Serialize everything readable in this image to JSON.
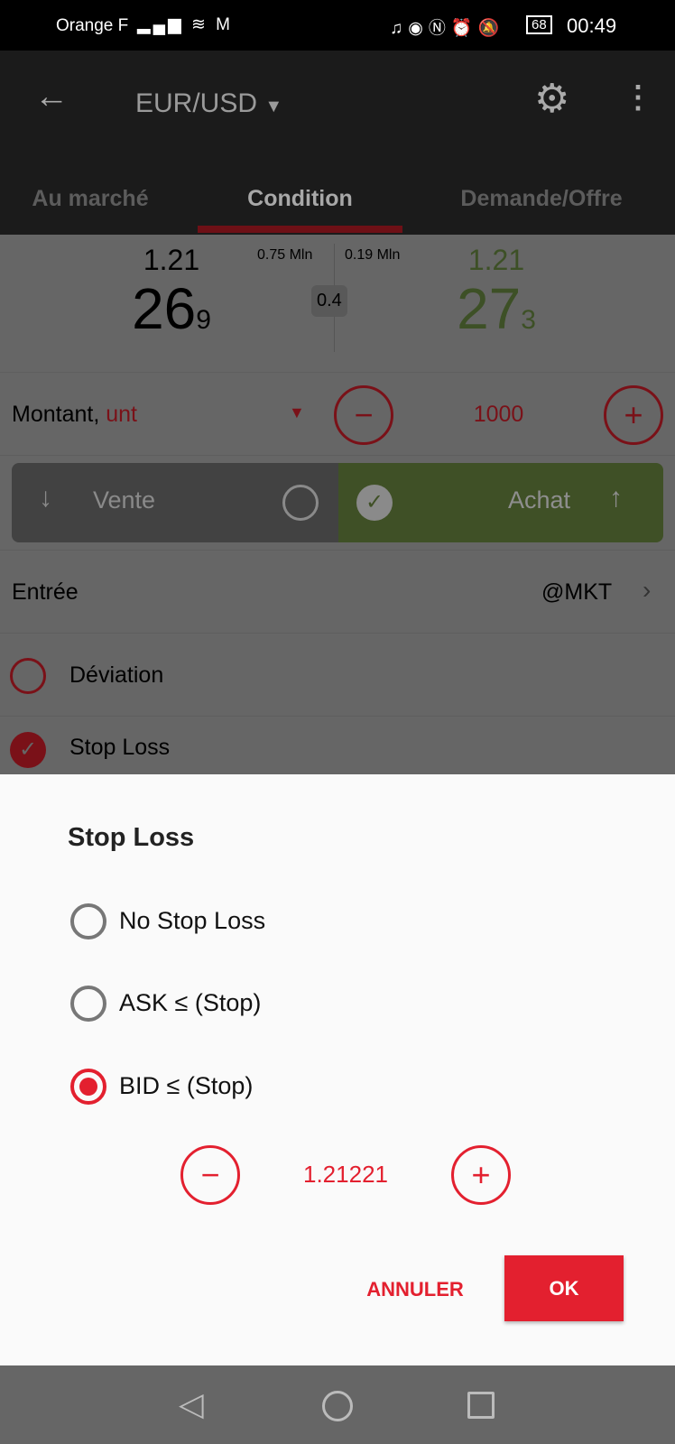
{
  "status_bar": {
    "carrier": "Orange F",
    "battery": "68",
    "time": "00:49",
    "icons": [
      "signal-icon",
      "wifi-icon",
      "mail-icon",
      "headphones-icon",
      "eye-icon",
      "nfc-icon",
      "alarm-icon",
      "mute-icon",
      "battery-icon"
    ]
  },
  "header": {
    "symbol": "EUR/USD",
    "tabs": [
      {
        "label": "Au marché"
      },
      {
        "label": "Condition",
        "active": true
      },
      {
        "label": "Demande/Offre"
      }
    ]
  },
  "quote": {
    "bid_prefix": "1.21",
    "bid_big": "26",
    "bid_small": "9",
    "ask_prefix": "1.21",
    "ask_big": "27",
    "ask_small": "3",
    "bid_volume": "0.75 Mln",
    "ask_volume": "0.19 Mln",
    "spread": "0.4"
  },
  "amount": {
    "label": "Montant,",
    "unit": "unt",
    "value": "1000"
  },
  "direction": {
    "sell": "Vente",
    "buy": "Achat",
    "selected": "buy"
  },
  "entry": {
    "label": "Entrée",
    "value": "@MKT"
  },
  "options": [
    {
      "label": "Déviation",
      "checked": false
    },
    {
      "label": "Stop Loss",
      "checked": true
    }
  ],
  "dialog": {
    "title": "Stop Loss",
    "choices": [
      {
        "label": "No Stop Loss",
        "selected": false
      },
      {
        "label": "ASK ≤ (Stop)",
        "selected": false
      },
      {
        "label": "BID ≤ (Stop)",
        "selected": true
      }
    ],
    "value": "1.21221",
    "cancel": "ANNULER",
    "ok": "OK"
  },
  "colors": {
    "accent": "#e3202f",
    "buy": "#7ea844",
    "sell": "#5a5a5a"
  }
}
